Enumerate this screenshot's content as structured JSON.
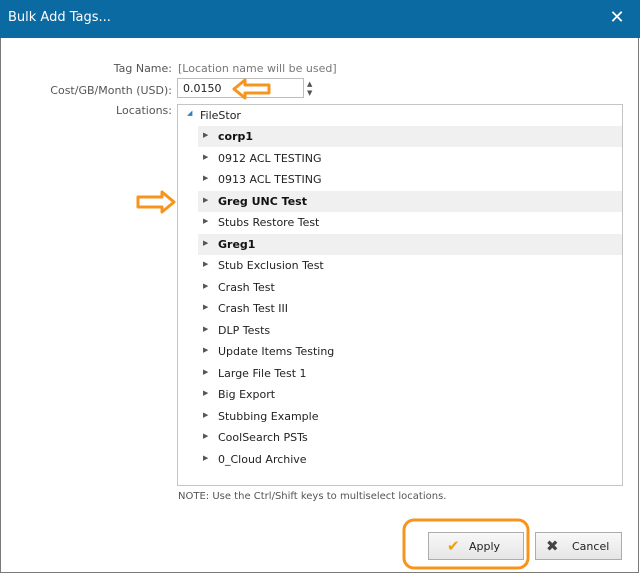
{
  "window": {
    "title": "Bulk Add Tags...",
    "close_symbol": "✕"
  },
  "form": {
    "tag_name_label": "Tag Name:",
    "tag_name_value": "[Location name will be used]",
    "cost_label": "Cost/GB/Month (USD):",
    "cost_value": "0.0150",
    "locations_label": "Locations:"
  },
  "tree": {
    "root": "FileStor",
    "items": [
      {
        "label": "corp1",
        "highlighted": true
      },
      {
        "label": "0912 ACL TESTING",
        "highlighted": false
      },
      {
        "label": "0913 ACL TESTING",
        "highlighted": false
      },
      {
        "label": "Greg UNC Test",
        "highlighted": true
      },
      {
        "label": "Stubs Restore Test",
        "highlighted": false
      },
      {
        "label": "Greg1",
        "highlighted": true
      },
      {
        "label": "Stub Exclusion Test",
        "highlighted": false
      },
      {
        "label": "Crash Test",
        "highlighted": false
      },
      {
        "label": "Crash Test III",
        "highlighted": false
      },
      {
        "label": "DLP Tests",
        "highlighted": false
      },
      {
        "label": "Update Items Testing",
        "highlighted": false
      },
      {
        "label": "Large File Test 1",
        "highlighted": false
      },
      {
        "label": "Big Export",
        "highlighted": false
      },
      {
        "label": "Stubbing Example",
        "highlighted": false
      },
      {
        "label": "CoolSearch PSTs",
        "highlighted": false
      },
      {
        "label": "0_Cloud Archive",
        "highlighted": false
      }
    ]
  },
  "note": "NOTE: Use the Ctrl/Shift keys to multiselect locations.",
  "buttons": {
    "apply_label": "Apply",
    "cancel_label": "Cancel"
  },
  "colors": {
    "titlebar": "#0b6aa1",
    "annotation": "#f7941d",
    "highlight_row": "#f0f0f0"
  },
  "icons": {
    "apply": "checkmark-icon",
    "cancel": "x-icon",
    "expand": "triangle-right-icon"
  }
}
